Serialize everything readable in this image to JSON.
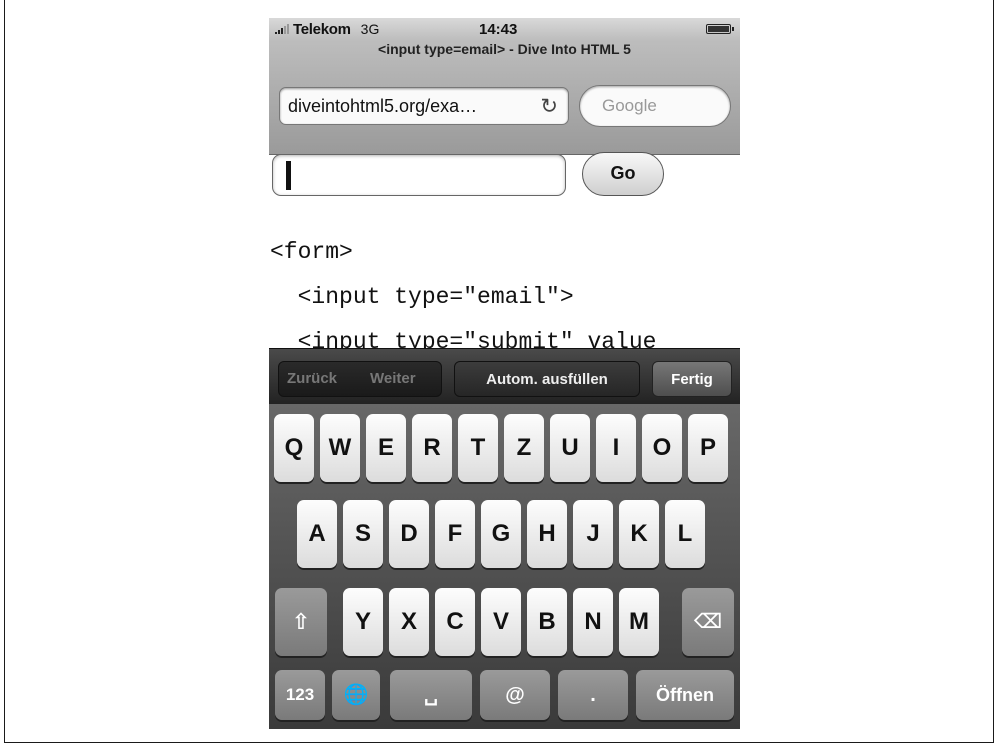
{
  "status": {
    "carrier": "Telekom",
    "network": "3G",
    "time": "14:43"
  },
  "browser": {
    "title": "<input type=email> - Dive Into HTML 5",
    "url": "diveintohtml5.org/exa…",
    "search_placeholder": "Google"
  },
  "form": {
    "go_label": "Go"
  },
  "code_lines": [
    "<form>",
    "  <input type=\"email\">",
    "  <input type=\"submit\" value"
  ],
  "toolbar": {
    "prev": "Zurück",
    "next": "Weiter",
    "autofill": "Autom. ausfüllen",
    "done": "Fertig"
  },
  "keyboard": {
    "row1": [
      "Q",
      "W",
      "E",
      "R",
      "T",
      "Z",
      "U",
      "I",
      "O",
      "P"
    ],
    "row2": [
      "A",
      "S",
      "D",
      "F",
      "G",
      "H",
      "J",
      "K",
      "L"
    ],
    "row3": [
      "Y",
      "X",
      "C",
      "V",
      "B",
      "N",
      "M"
    ],
    "numbers": "123",
    "at": "@",
    "dot": ".",
    "return": "Öffnen",
    "icons": [
      "shift-icon",
      "backspace-icon",
      "globe-icon",
      "space-icon"
    ]
  }
}
